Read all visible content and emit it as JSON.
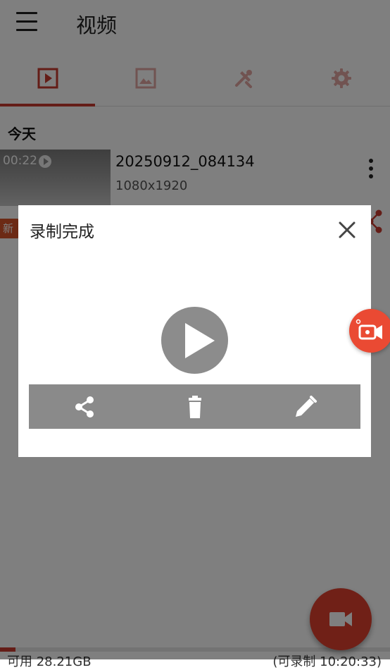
{
  "app": {
    "title": "视频"
  },
  "tabs": [
    {
      "id": "videos",
      "icon": "video-play-icon",
      "selected": true
    },
    {
      "id": "images",
      "icon": "image-icon",
      "selected": false
    },
    {
      "id": "tools",
      "icon": "tools-icon",
      "selected": false
    },
    {
      "id": "settings",
      "icon": "gear-icon",
      "selected": false
    }
  ],
  "list": {
    "section_header": "今天",
    "items": [
      {
        "duration": "00:22",
        "name": "20250912_084134",
        "resolution": "1080x1920",
        "badge": "新"
      }
    ]
  },
  "dialog": {
    "title": "录制完成",
    "actions": [
      {
        "id": "share",
        "icon": "share-icon"
      },
      {
        "id": "delete",
        "icon": "trash-icon"
      },
      {
        "id": "edit",
        "icon": "pencil-icon"
      }
    ]
  },
  "storage": {
    "left": "可用 28.21GB",
    "right": "(可录制 10:20:33)"
  },
  "colors": {
    "accent": "#c93a2f",
    "fab": "#e0412f",
    "bubble": "#ea4a33",
    "icon_inactive": "#e3a7a2"
  }
}
